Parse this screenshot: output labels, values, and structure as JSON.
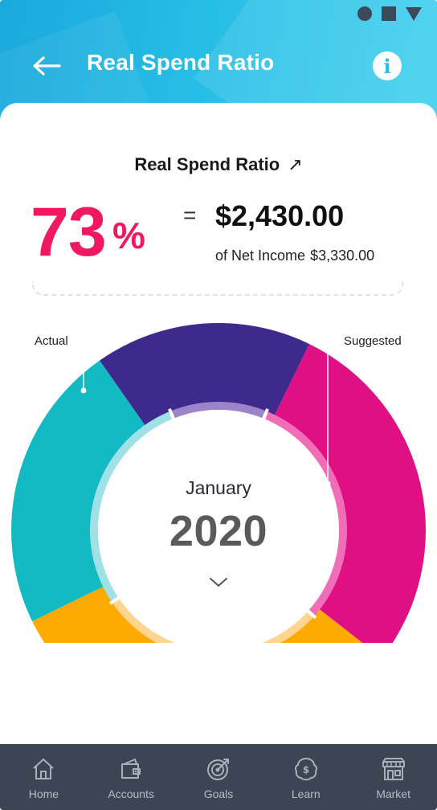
{
  "header": {
    "title": "Real Spend Ratio",
    "back_icon": "arrow-left-icon",
    "info_icon": "info-icon"
  },
  "summary": {
    "heading": "Real Spend Ratio",
    "heading_arrow": "↗",
    "percent": "73",
    "percent_sign": "%",
    "equals": "=",
    "spend_amount": "$2,430.00",
    "net_income_label": "of Net Income",
    "net_income_amount": "$3,330.00"
  },
  "chart": {
    "label_actual": "Actual",
    "label_suggested": "Suggested",
    "month": "January",
    "year": "2020",
    "colors": {
      "teal": "#12bac3",
      "purple": "#3e2a8c",
      "magenta": "#e00f84",
      "orange": "#ffaa00"
    },
    "inner_colors": {
      "teal": "#9fe1e6",
      "purple": "#9b84c8",
      "magenta": "#f06db7",
      "orange": "#ffd590"
    }
  },
  "nav": {
    "items": [
      {
        "label": "Home",
        "icon": "home-icon"
      },
      {
        "label": "Accounts",
        "icon": "wallet-icon"
      },
      {
        "label": "Goals",
        "icon": "target-icon"
      },
      {
        "label": "Learn",
        "icon": "brain-dollar-icon"
      },
      {
        "label": "Market",
        "icon": "store-icon"
      }
    ]
  }
}
